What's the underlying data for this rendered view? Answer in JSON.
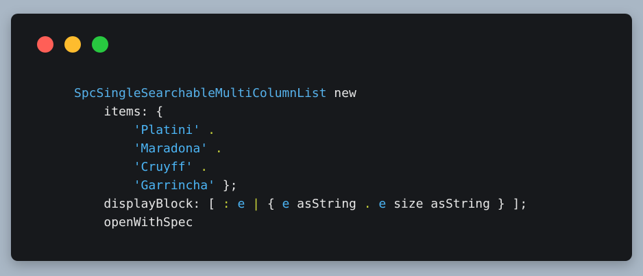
{
  "window": {
    "controls": [
      {
        "name": "close",
        "color": "#ff5f57"
      },
      {
        "name": "minimize",
        "color": "#febc2e"
      },
      {
        "name": "maximize",
        "color": "#28c840"
      }
    ]
  },
  "code": {
    "line1": {
      "class_name": "SpcSingleSearchableMultiColumnList",
      "message": " new"
    },
    "line2": {
      "keyword": "items:",
      "rest": " {"
    },
    "line3": {
      "string": "'Platini'",
      "op": " ."
    },
    "line4": {
      "string": "'Maradona'",
      "op": " ."
    },
    "line5": {
      "string": "'Cruyff'",
      "op": " ."
    },
    "line6": {
      "string": "'Garrincha'",
      "rest": " };"
    },
    "line7": {
      "keyword": "displayBlock:",
      "p1": " [ ",
      "colon": ":",
      "space1": " ",
      "var1": "e",
      "space2": " ",
      "pipe": "|",
      "p2": " { ",
      "var2": "e",
      "p3": " asString ",
      "dot": ".",
      "space3": " ",
      "var3": "e",
      "p4": " size asString } ];"
    },
    "line8": {
      "message": "openWithSpec"
    }
  }
}
